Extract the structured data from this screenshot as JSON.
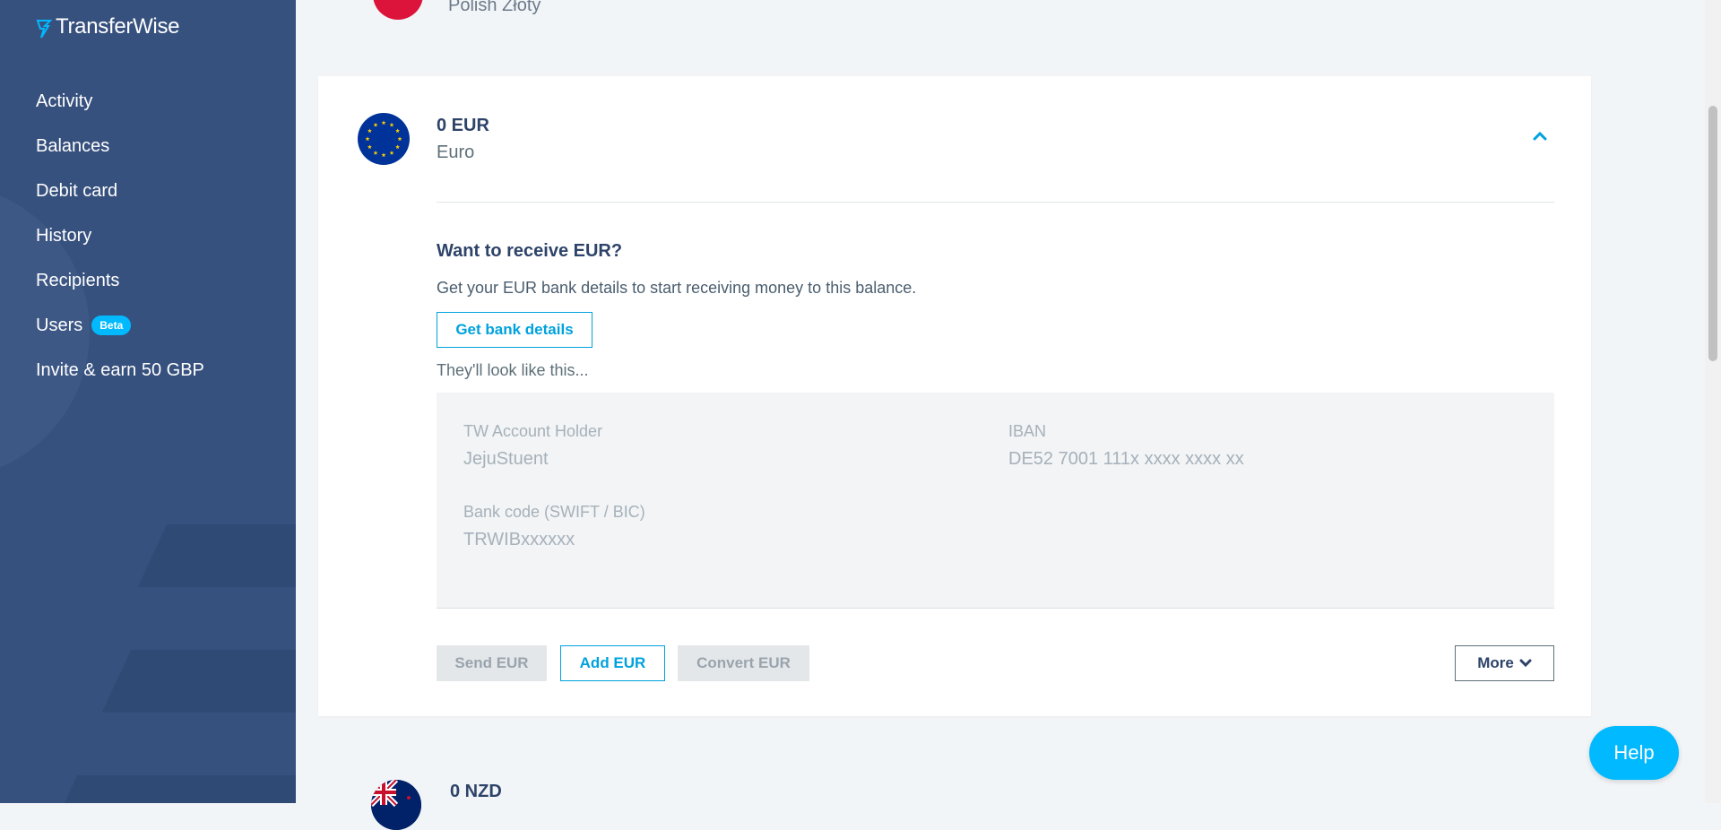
{
  "app": {
    "logo_text": "TransferWise"
  },
  "sidebar": {
    "items": [
      {
        "label": "Activity"
      },
      {
        "label": "Balances"
      },
      {
        "label": "Debit card"
      },
      {
        "label": "History"
      },
      {
        "label": "Recipients"
      },
      {
        "label": "Users",
        "badge": "Beta"
      },
      {
        "label": "Invite & earn 50 GBP"
      }
    ]
  },
  "previous_balance": {
    "name": "Polish Złoty",
    "flag_icon": "poland-flag-icon"
  },
  "balance_card": {
    "amount": "0 EUR",
    "currency_name": "Euro",
    "flag_icon": "eu-flag-icon",
    "receive_title": "Want to receive EUR?",
    "receive_desc": "Get your EUR bank details to start receiving money to this balance.",
    "get_bank_details_label": "Get bank details",
    "preview_intro": "They'll look like this...",
    "preview": {
      "account_holder_label": "TW Account Holder",
      "account_holder_value": "JejuStuent",
      "iban_label": "IBAN",
      "iban_value": "DE52 7001 111x xxxx xxxx xx",
      "bank_code_label": "Bank code (SWIFT / BIC)",
      "bank_code_value": "TRWIBxxxxxx"
    },
    "actions": {
      "send_label": "Send EUR",
      "add_label": "Add EUR",
      "convert_label": "Convert EUR",
      "more_label": "More"
    }
  },
  "next_balance": {
    "amount": "0 NZD",
    "flag_icon": "new-zealand-flag-icon"
  },
  "help_label": "Help",
  "colors": {
    "sidebar_bg": "#37517e",
    "accent": "#00b9ff",
    "link_blue": "#00a2dd",
    "text_dark": "#2e4369"
  }
}
